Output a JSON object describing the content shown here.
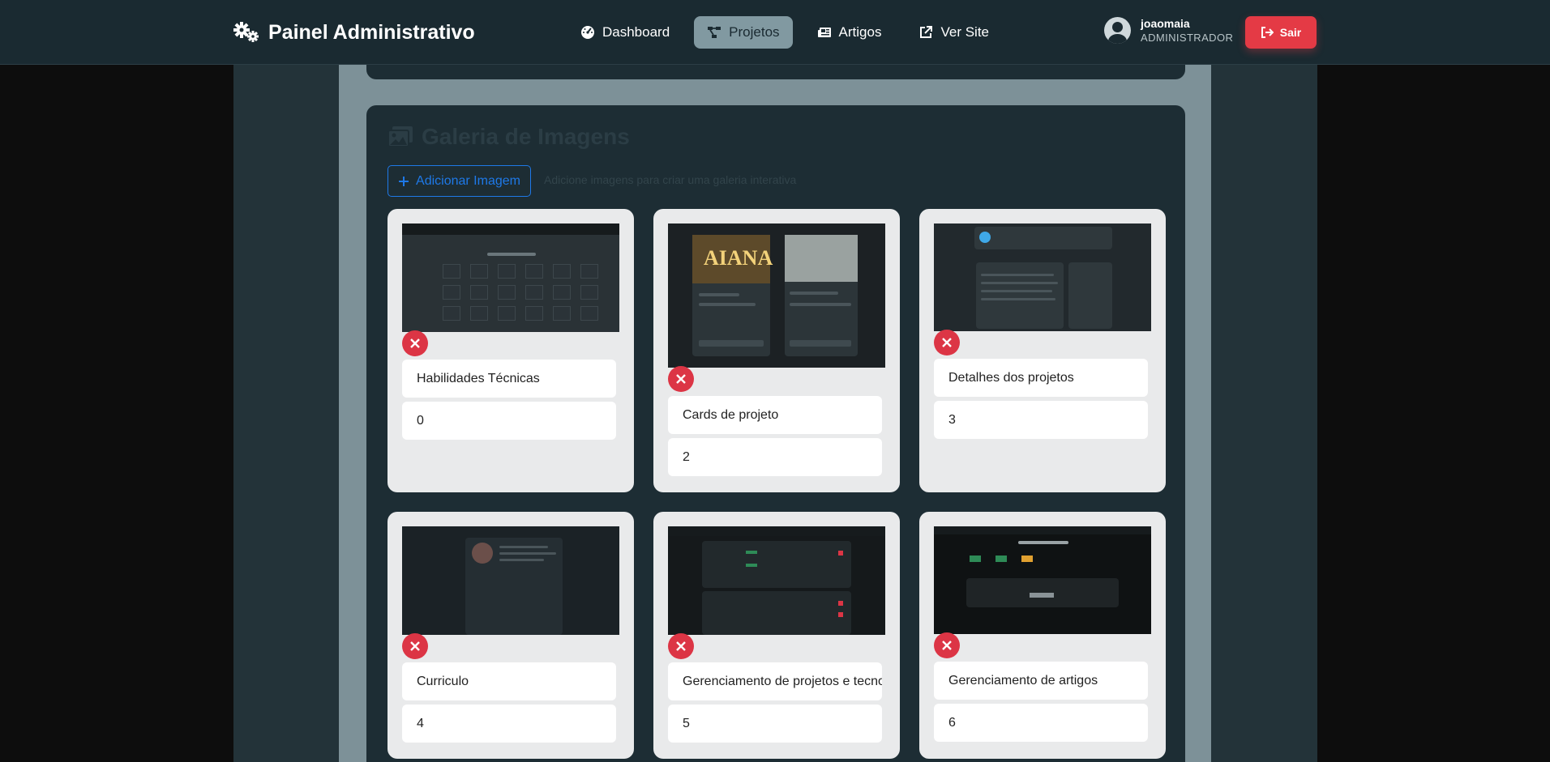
{
  "brand": {
    "title": "Painel Administrativo"
  },
  "nav": [
    {
      "label": "Dashboard",
      "icon": "gauge-icon",
      "active": false
    },
    {
      "label": "Projetos",
      "icon": "project-diagram-icon",
      "active": true
    },
    {
      "label": "Artigos",
      "icon": "newspaper-icon",
      "active": false
    },
    {
      "label": "Ver Site",
      "icon": "external-link-icon",
      "active": false
    }
  ],
  "user": {
    "name": "joaomaia",
    "role": "ADMINISTRADOR"
  },
  "logout_label": "Sair",
  "gallery": {
    "title": "Galeria de Imagens",
    "add_label": "Adicionar Imagem",
    "help_text": "Adicione imagens para criar uma galeria interativa",
    "items": [
      {
        "caption": "Habilidades Técnicas",
        "order": "0"
      },
      {
        "caption": "Cards de projeto",
        "order": "2"
      },
      {
        "caption": "Detalhes dos projetos",
        "order": "3"
      },
      {
        "caption": "Curriculo",
        "order": "4"
      },
      {
        "caption": "Gerenciamento de projetos e tecnologias",
        "order": "5"
      },
      {
        "caption": "Gerenciamento de artigos",
        "order": "6"
      }
    ]
  },
  "colors": {
    "navbar_bg": "#1a2a31",
    "accent_active": "#8199a1",
    "danger": "#e43a45",
    "primary": "#1e79e8"
  }
}
